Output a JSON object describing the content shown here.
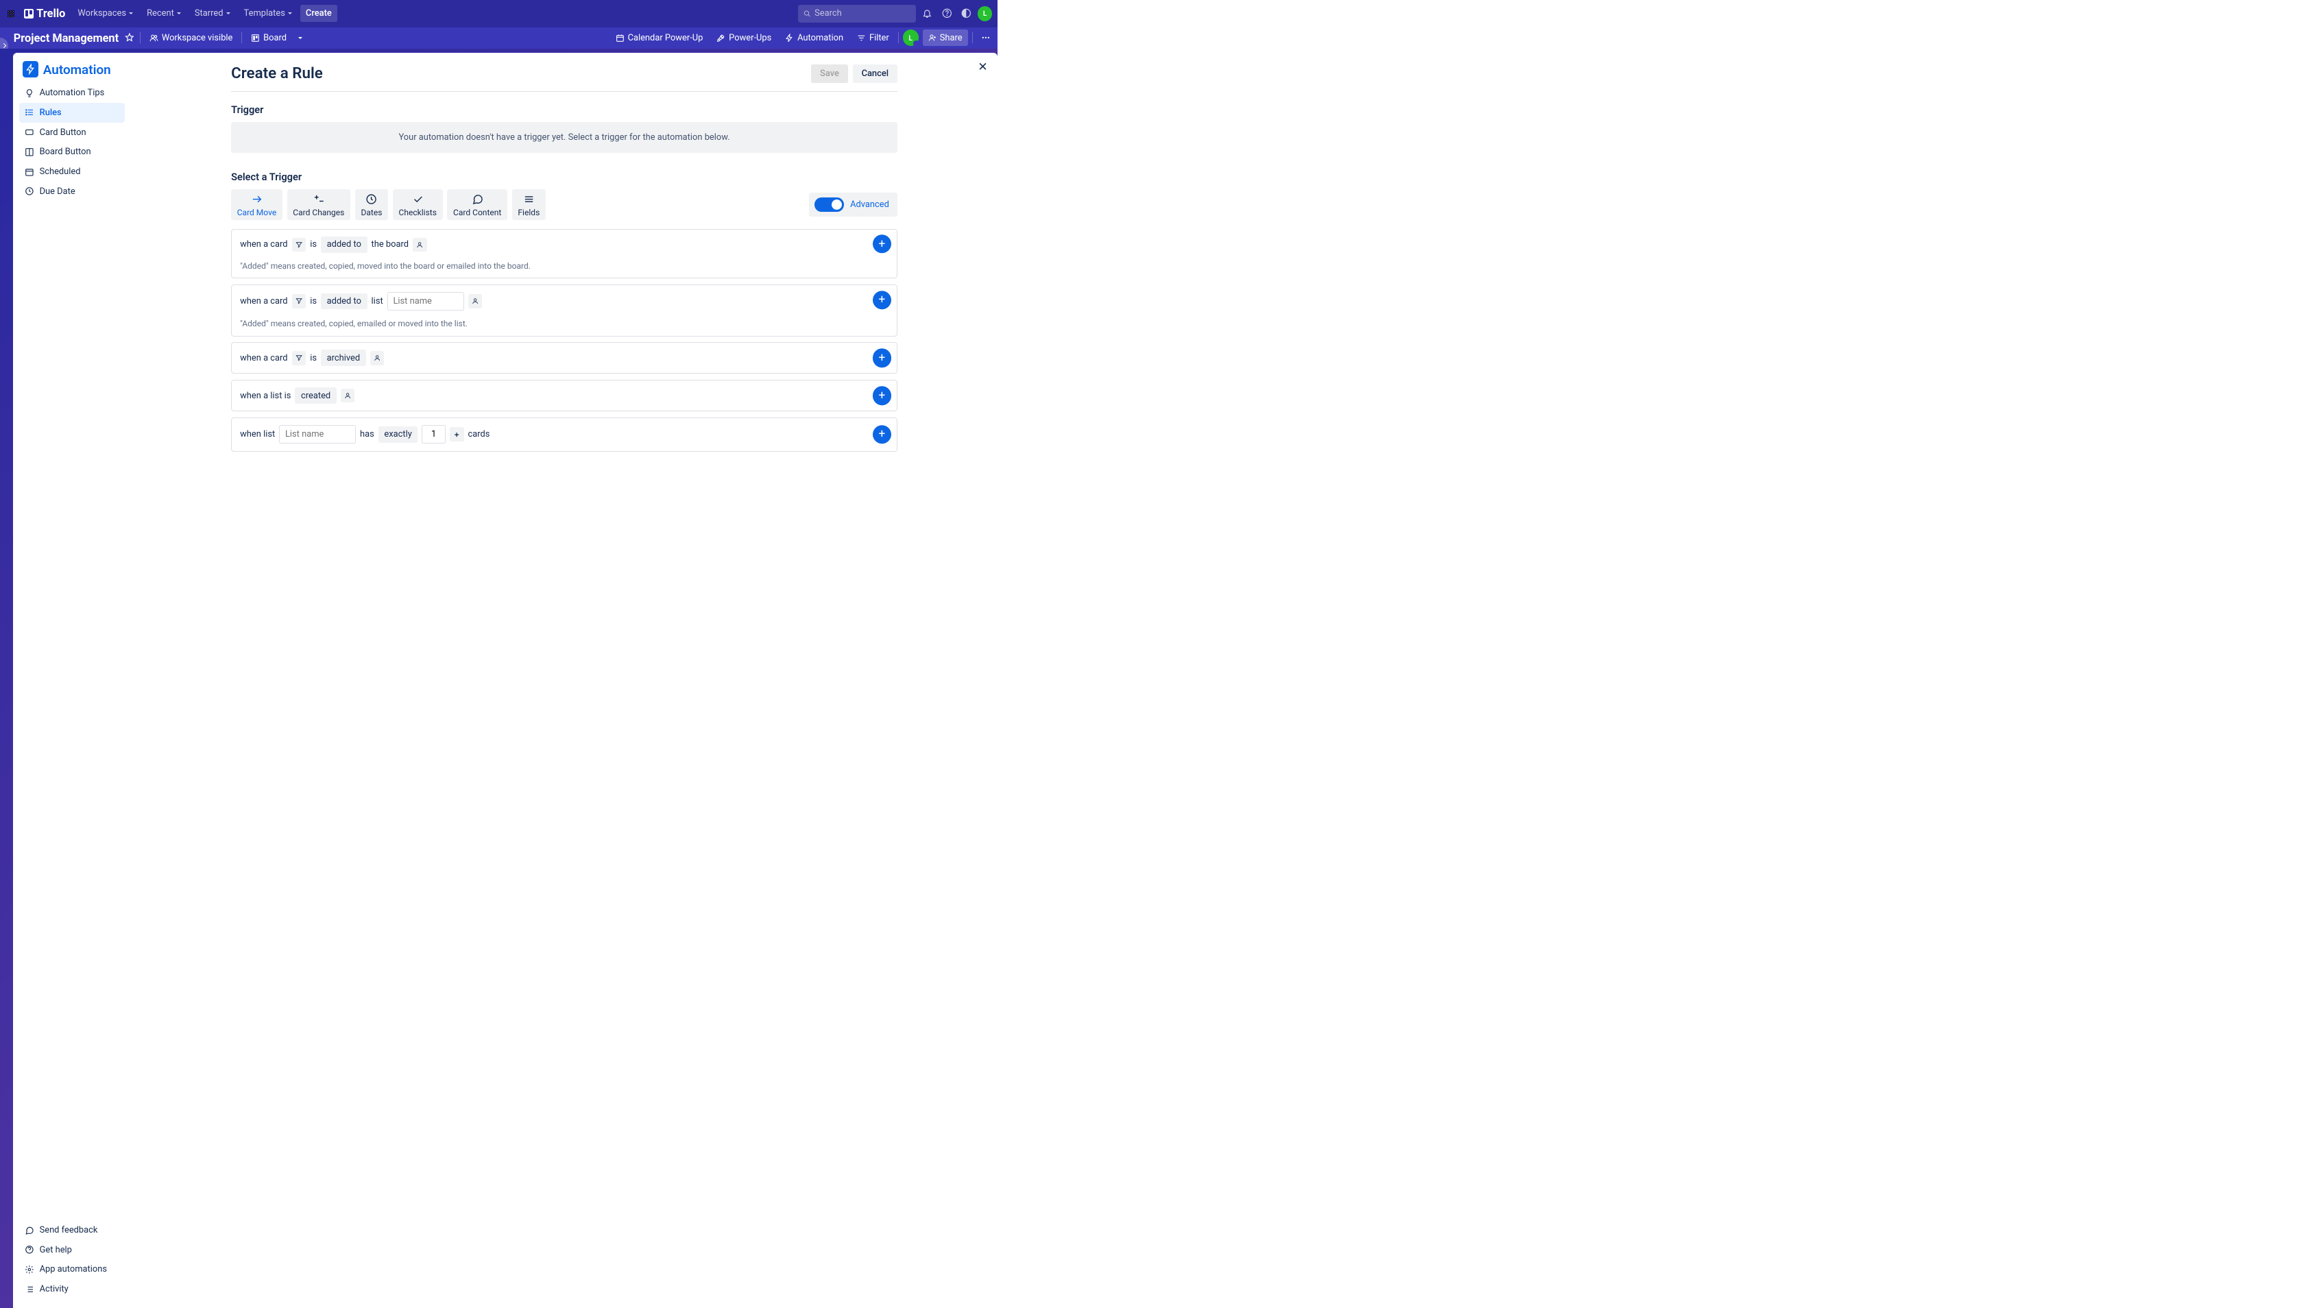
{
  "topNav": {
    "logo": "Trello",
    "workspaces": "Workspaces",
    "recent": "Recent",
    "starred": "Starred",
    "templates": "Templates",
    "create": "Create",
    "searchPlaceholder": "Search",
    "avatar": "L"
  },
  "boardBar": {
    "title": "Project Management",
    "workspaceVisible": "Workspace visible",
    "board": "Board",
    "calendarPowerUp": "Calendar Power-Up",
    "powerUps": "Power-Ups",
    "automation": "Automation",
    "filter": "Filter",
    "avatar": "L",
    "share": "Share"
  },
  "sidebar": {
    "title": "Automation",
    "items": [
      "Automation Tips",
      "Rules",
      "Card Button",
      "Board Button",
      "Scheduled",
      "Due Date"
    ],
    "footer": [
      "Send feedback",
      "Get help",
      "App automations",
      "Activity"
    ]
  },
  "page": {
    "title": "Create a Rule",
    "save": "Save",
    "cancel": "Cancel",
    "triggerHeading": "Trigger",
    "triggerEmpty": "Your automation doesn't have a trigger yet. Select a trigger for the automation below.",
    "selectTrigger": "Select a Trigger",
    "tabs": [
      "Card Move",
      "Card Changes",
      "Dates",
      "Checklists",
      "Card Content",
      "Fields"
    ],
    "advanced": "Advanced",
    "triggers": {
      "whenCard": "when a card",
      "is": "is",
      "addedTo": "added to",
      "theBoard": "the board",
      "hint1": "\"Added\" means created, copied, moved into the board or emailed into the board.",
      "list": "list",
      "listPlaceholder": "List name",
      "hint2": "\"Added\" means created, copied, emailed or moved into the list.",
      "archived": "archived",
      "whenListIs": "when a list is",
      "created": "created",
      "whenList": "when list",
      "has": "has",
      "exactly": "exactly",
      "one": "1",
      "cards": "cards"
    }
  }
}
